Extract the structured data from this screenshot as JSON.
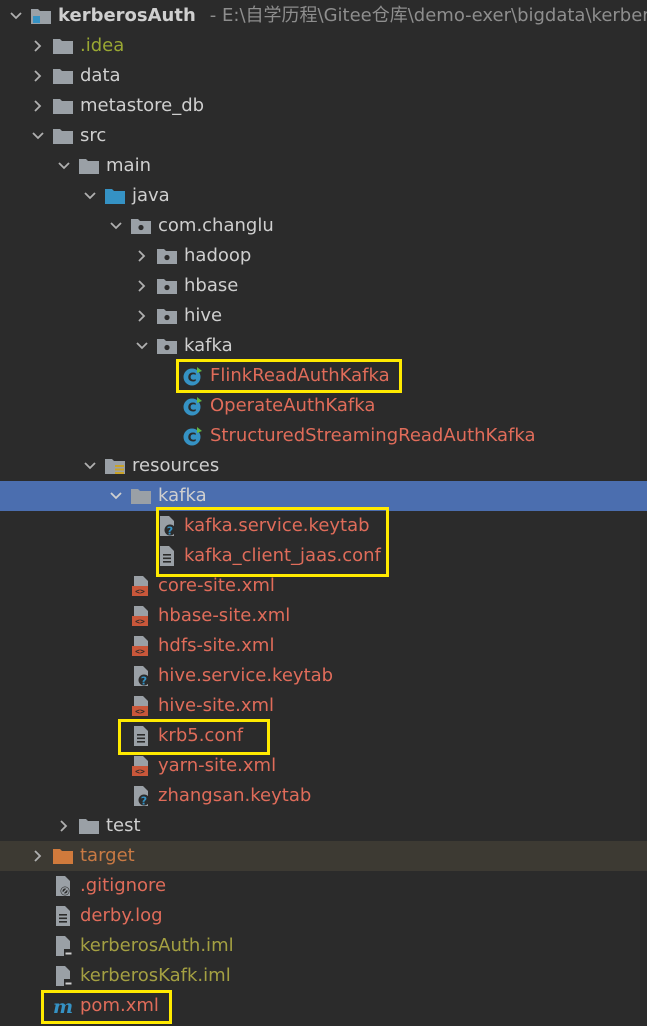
{
  "root": {
    "name": "kerberosAuth",
    "path": "- E:\\自学历程\\Gitee仓库\\demo-exer\\bigdata\\kerberos"
  },
  "items": {
    "idea": ".idea",
    "data": "data",
    "metastore_db": "metastore_db",
    "src": "src",
    "main": "main",
    "java": "java",
    "pkg": "com.changlu",
    "hadoop": "hadoop",
    "hbase": "hbase",
    "hive": "hive",
    "kafka_pkg": "kafka",
    "flink": "FlinkReadAuthKafka",
    "operate": "OperateAuthKafka",
    "structured": "StructuredStreamingReadAuthKafka",
    "resources": "resources",
    "kafka_res": "kafka",
    "kafka_keytab": "kafka.service.keytab",
    "kafka_jaas": "kafka_client_jaas.conf",
    "core_site": "core-site.xml",
    "hbase_site": "hbase-site.xml",
    "hdfs_site": "hdfs-site.xml",
    "hive_keytab": "hive.service.keytab",
    "hive_site": "hive-site.xml",
    "krb5": "krb5.conf",
    "yarn_site": "yarn-site.xml",
    "zhangsan": "zhangsan.keytab",
    "test": "test",
    "target": "target",
    "gitignore": ".gitignore",
    "derby": "derby.log",
    "iml1": "kerberosAuth.iml",
    "iml2": "kerberosKafk.iml",
    "pom": "pom.xml"
  },
  "colors": {
    "background": "#2b2b2b",
    "selection": "#4b6eaf",
    "highlight_box": "#ffea00",
    "modified_red": "#e06c5a",
    "ignored_olive": "#9aa833",
    "excluded_orange": "#c97a44"
  }
}
